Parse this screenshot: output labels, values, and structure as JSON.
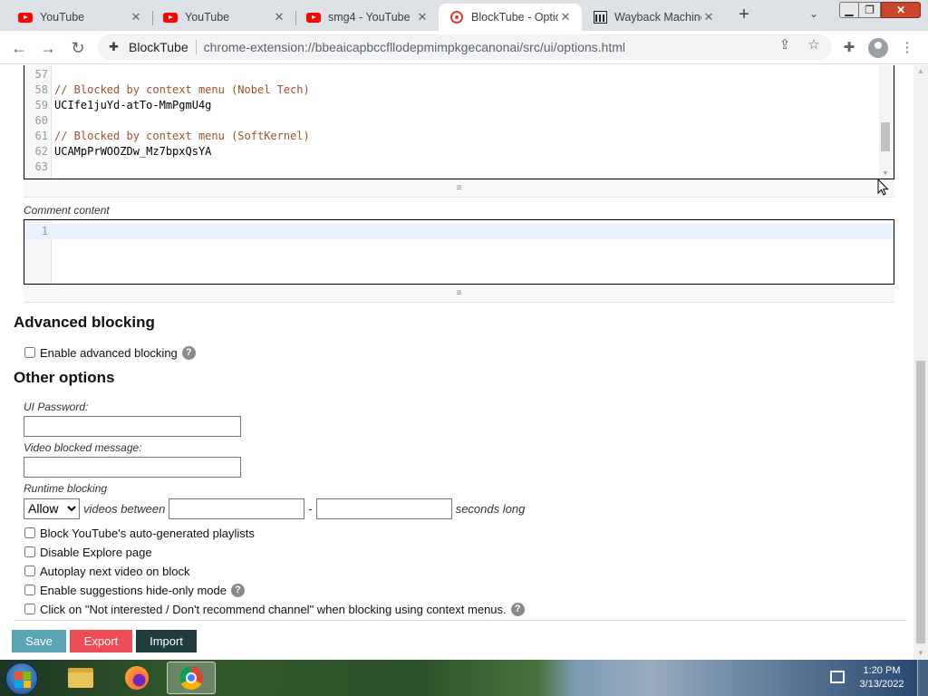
{
  "tabs": [
    {
      "label": "YouTube",
      "icon": "youtube-icon"
    },
    {
      "label": "YouTube",
      "icon": "youtube-icon"
    },
    {
      "label": "smg4 - YouTube",
      "icon": "youtube-icon"
    },
    {
      "label": "BlockTube - Optio",
      "icon": "blocktube-icon"
    },
    {
      "label": "Wayback Machine",
      "icon": "wayback-icon"
    }
  ],
  "toolbar": {
    "site_name": "BlockTube",
    "url": "chrome-extension://bbeaicapbccfllodepmimpkgecanonai/src/ui/options.html"
  },
  "channels_editor": {
    "lines": [
      {
        "num": "57",
        "text": "",
        "type": "code"
      },
      {
        "num": "58",
        "text": "// Blocked by context menu (Nobel Tech)",
        "type": "comment"
      },
      {
        "num": "59",
        "text": "UCIfe1juYd-atTo-MmPgmU4g",
        "type": "code"
      },
      {
        "num": "60",
        "text": "",
        "type": "code"
      },
      {
        "num": "61",
        "text": "// Blocked by context menu (SoftKernel)",
        "type": "comment"
      },
      {
        "num": "62",
        "text": "UCAMpPrWOOZDw_Mz7bpxQsYA",
        "type": "code"
      },
      {
        "num": "63",
        "text": "",
        "type": "code"
      }
    ]
  },
  "comment_content": {
    "label": "Comment content",
    "lines": [
      {
        "num": "1",
        "text": ""
      }
    ]
  },
  "advanced_blocking": {
    "heading": "Advanced blocking",
    "enable_label": "Enable advanced blocking"
  },
  "other_options": {
    "heading": "Other options",
    "ui_password_label": "UI Password:",
    "video_blocked_label": "Video blocked message:",
    "runtime_label": "Runtime blocking",
    "runtime_select_value": "Allow",
    "runtime_videos_between": "videos between",
    "runtime_dash": "-",
    "runtime_seconds_long": "seconds long",
    "checkboxes": [
      {
        "label": "Block YouTube's auto-generated playlists",
        "help": false
      },
      {
        "label": "Disable Explore page",
        "help": false
      },
      {
        "label": "Autoplay next video on block",
        "help": false
      },
      {
        "label": "Enable suggestions hide-only mode",
        "help": true
      },
      {
        "label": "Click on \"Not interested / Don't recommend channel\" when blocking using context menus.",
        "help": true
      }
    ]
  },
  "buttons": {
    "save": "Save",
    "export": "Export",
    "import": "Import"
  },
  "colors": {
    "save": "#5ba4b5",
    "export": "#ef4d55",
    "import": "#1f3c3e",
    "comment": "#a0522d"
  },
  "taskbar": {
    "time": "1:20 PM",
    "date": "3/13/2022"
  }
}
